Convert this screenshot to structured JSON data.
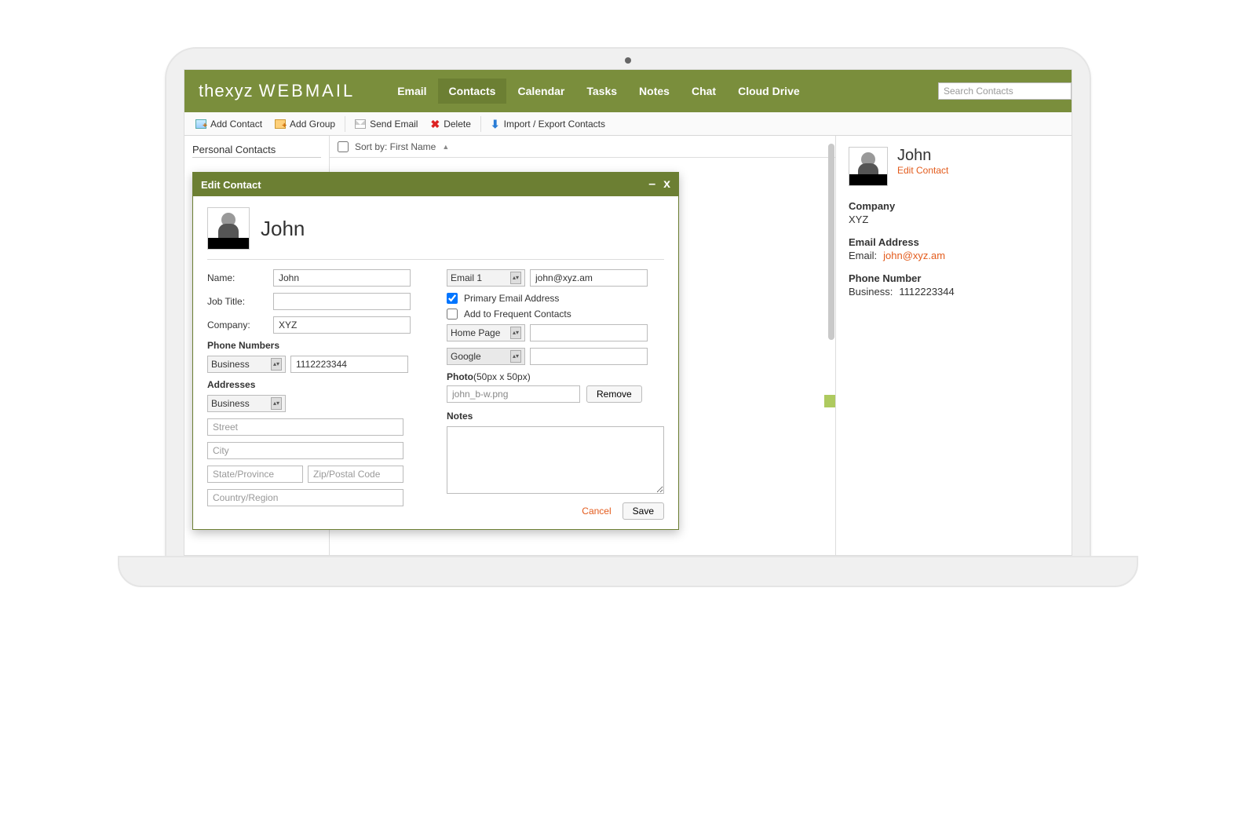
{
  "brand": {
    "part1": "thexyz",
    "part2": "WEBMAIL"
  },
  "nav": {
    "email": "Email",
    "contacts": "Contacts",
    "calendar": "Calendar",
    "tasks": "Tasks",
    "notes": "Notes",
    "chat": "Chat",
    "cloud": "Cloud Drive"
  },
  "search": {
    "placeholder": "Search Contacts"
  },
  "toolbar": {
    "add_contact": "Add Contact",
    "add_group": "Add Group",
    "send_email": "Send Email",
    "delete": "Delete",
    "import_export": "Import / Export Contacts"
  },
  "left": {
    "personal_contacts": "Personal Contacts"
  },
  "sort": {
    "label": "Sort by: First Name",
    "arrow": "▲"
  },
  "details": {
    "name": "John",
    "edit_link": "Edit Contact",
    "company_lbl": "Company",
    "company_val": "XYZ",
    "email_lbl": "Email Address",
    "email_key": "Email:",
    "email_val": "john@xyz.am",
    "phone_lbl": "Phone Number",
    "phone_key": "Business:",
    "phone_val": "1112223344"
  },
  "dialog": {
    "title": "Edit Contact",
    "header_name": "John",
    "name_lbl": "Name:",
    "name_val": "John",
    "jobtitle_lbl": "Job Title:",
    "jobtitle_val": "",
    "company_lbl": "Company:",
    "company_val": "XYZ",
    "phone_sect": "Phone Numbers",
    "phone_type": "Business",
    "phone_val": "1112223344",
    "addr_sect": "Addresses",
    "addr_type": "Business",
    "street_ph": "Street",
    "city_ph": "City",
    "state_ph": "State/Province",
    "zip_ph": "Zip/Postal Code",
    "country_ph": "Country/Region",
    "email_type": "Email 1",
    "email_val": "john@xyz.am",
    "primary_chk": "Primary Email Address",
    "freq_chk": "Add to Frequent Contacts",
    "homepage_sel": "Home Page",
    "google_sel": "Google",
    "photo_lbl": "Photo",
    "photo_dim": "(50px x 50px)",
    "photo_file": "john_b-w.png",
    "remove_btn": "Remove",
    "notes_lbl": "Notes",
    "cancel": "Cancel",
    "save": "Save"
  }
}
